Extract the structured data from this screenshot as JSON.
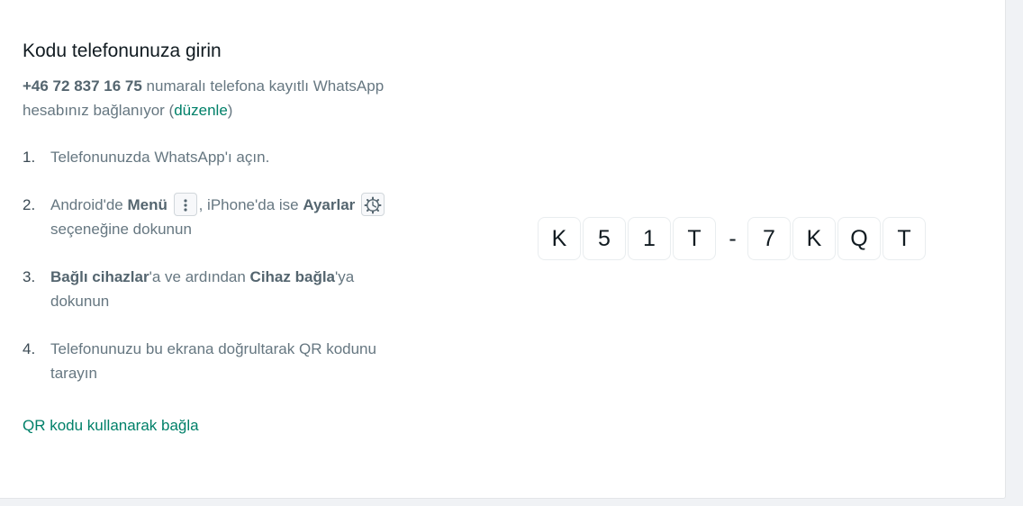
{
  "header": {
    "title": "Kodu telefonunuza girin"
  },
  "subtitle": {
    "phone": "+46 72 837 16 75",
    "text_before_link": " numaralı telefona kayıtlı WhatsApp hesabınız bağlanıyor (",
    "edit_link": "düzenle",
    "text_after_link": ")"
  },
  "steps": [
    {
      "num": "1.",
      "text": "Telefonunuzda WhatsApp'ı açın."
    },
    {
      "num": "2.",
      "part1": "Android'de ",
      "bold1": "Menü",
      "part2": ", iPhone'da ise ",
      "bold2": "Ayarlar",
      "part3": "seçeneğine dokunun",
      "icon1": "more-vertical-icon",
      "icon2": "settings-gear-icon"
    },
    {
      "num": "3.",
      "bold1": "Bağlı cihazlar",
      "part1": "'a ve ardından ",
      "bold2": "Cihaz bağla",
      "part2": "'ya dokunun"
    },
    {
      "num": "4.",
      "text": "Telefonunuzu bu ekrana doğrultarak QR kodunu tarayın"
    }
  ],
  "qr_link": "QR kodu kullanarak bağla",
  "code": {
    "first": [
      "K",
      "5",
      "1",
      "T"
    ],
    "separator": "-",
    "second": [
      "7",
      "K",
      "Q",
      "T"
    ]
  },
  "colors": {
    "accent": "#008069",
    "text_primary": "#111b21",
    "text_secondary": "#667781"
  }
}
